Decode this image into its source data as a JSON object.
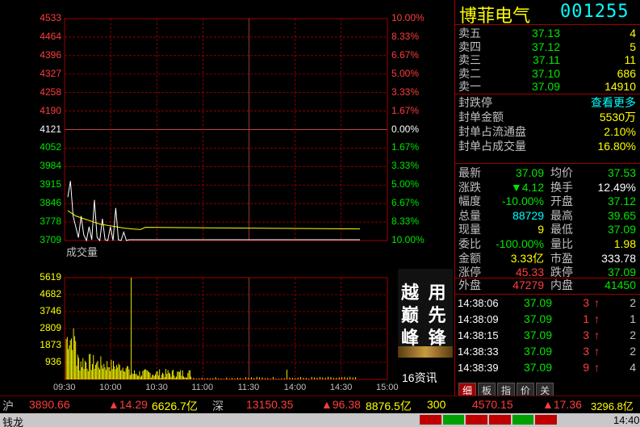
{
  "stock": {
    "name": "博菲电气",
    "code": "001255"
  },
  "price_axis": {
    "left": [
      "4533",
      "4464",
      "4396",
      "4327",
      "4258",
      "4190",
      "4121",
      "4052",
      "3984",
      "3915",
      "3846",
      "3778",
      "3709"
    ],
    "right": [
      "10.00%",
      "8.33%",
      "6.67%",
      "5.00%",
      "3.33%",
      "1.67%",
      "0.00%",
      "1.67%",
      "3.33%",
      "5.00%",
      "6.67%",
      "8.33%",
      "10.00%"
    ]
  },
  "volume_label": "成交量",
  "volume_axis": [
    "5619",
    "4682",
    "3746",
    "2809",
    "1873",
    "936"
  ],
  "time_axis": [
    "09:30",
    "10:00",
    "10:30",
    "11:00",
    "11:30",
    "14:00",
    "14:30",
    "15:00"
  ],
  "ad": {
    "line1": "越 用",
    "line2": "巅 先",
    "line3": "峰 锋"
  },
  "news": {
    "count": "16",
    "label": "资讯"
  },
  "order_book": [
    {
      "label": "卖五",
      "price": "37.13",
      "vol": "4"
    },
    {
      "label": "卖四",
      "price": "37.12",
      "vol": "5"
    },
    {
      "label": "卖三",
      "price": "37.11",
      "vol": "11"
    },
    {
      "label": "卖二",
      "price": "37.10",
      "vol": "686"
    },
    {
      "label": "卖一",
      "price": "37.09",
      "vol": "14910"
    }
  ],
  "limit": {
    "title": "封跌停",
    "more": "查看更多",
    "rows": [
      {
        "label": "封单金额",
        "value": "5530万"
      },
      {
        "label": "封单占流通盘",
        "value": "2.10%"
      },
      {
        "label": "封单占成交量",
        "value": "16.80%"
      }
    ]
  },
  "quote": [
    {
      "l1": "最新",
      "v1": "37.09",
      "l2": "均价",
      "v2": "37.53"
    },
    {
      "l1": "涨跌",
      "v1": "▼4.12",
      "l2": "换手",
      "v2": "12.49%"
    },
    {
      "l1": "幅度",
      "v1": "-10.00%",
      "l2": "开盘",
      "v2": "37.12"
    },
    {
      "l1": "总量",
      "v1": "88729",
      "l2": "最高",
      "v2": "39.65"
    },
    {
      "l1": "现量",
      "v1": "9",
      "l2": "最低",
      "v2": "37.09"
    },
    {
      "l1": "委比",
      "v1": "-100.00%",
      "l2": "量比",
      "v2": "1.98"
    },
    {
      "l1": "金额",
      "v1": "3.33亿",
      "l2": "市盈",
      "v2": "333.78"
    },
    {
      "l1": "涨停",
      "v1": "45.33",
      "l2": "跌停",
      "v2": "37.09"
    }
  ],
  "outer": {
    "l1": "外盘",
    "v1": "47279",
    "l2": "内盘",
    "v2": "41450"
  },
  "ticks": [
    {
      "time": "14:38:06",
      "price": "37.09",
      "vol": "3",
      "arrow": "↑",
      "n": "2"
    },
    {
      "time": "14:38:09",
      "price": "37.09",
      "vol": "1",
      "arrow": "↑",
      "n": "1"
    },
    {
      "time": "14:38:15",
      "price": "37.09",
      "vol": "3",
      "arrow": "↑",
      "n": "2"
    },
    {
      "time": "14:38:33",
      "price": "37.09",
      "vol": "3",
      "arrow": "↑",
      "n": "2"
    },
    {
      "time": "14:38:39",
      "price": "37.09",
      "vol": "9",
      "arrow": "↑",
      "n": "4"
    }
  ],
  "tabs": [
    "细",
    "板",
    "指",
    "价",
    "关"
  ],
  "index_bar": {
    "sh_label": "沪",
    "sh_val": "3890.66",
    "sh_chg": "▲14.29",
    "sh_amt": "6626.7亿",
    "sz_label": "深",
    "sz_val": "13150.35",
    "sz_chg": "▲96.38",
    "sz_amt": "8876.5亿",
    "c3_label": "300",
    "c3_val": "4570.15",
    "c3_chg": "▲17.36",
    "c3_amt": "3296.8亿"
  },
  "status_bar": {
    "left": "钱龙",
    "time": "14:40"
  },
  "chart_data": {
    "type": "line",
    "title": "",
    "x": [
      "09:30",
      "10:00",
      "10:30",
      "11:00",
      "11:30",
      "14:00",
      "14:30",
      "15:00"
    ],
    "ylim": [
      3709,
      4533
    ],
    "series": [
      {
        "name": "",
        "values": [
          3915,
          3830,
          3760,
          3712,
          3709,
          3709,
          3709,
          3709
        ]
      }
    ],
    "volume": {
      "ylim": [
        0,
        5619
      ],
      "peak": 5619
    }
  }
}
